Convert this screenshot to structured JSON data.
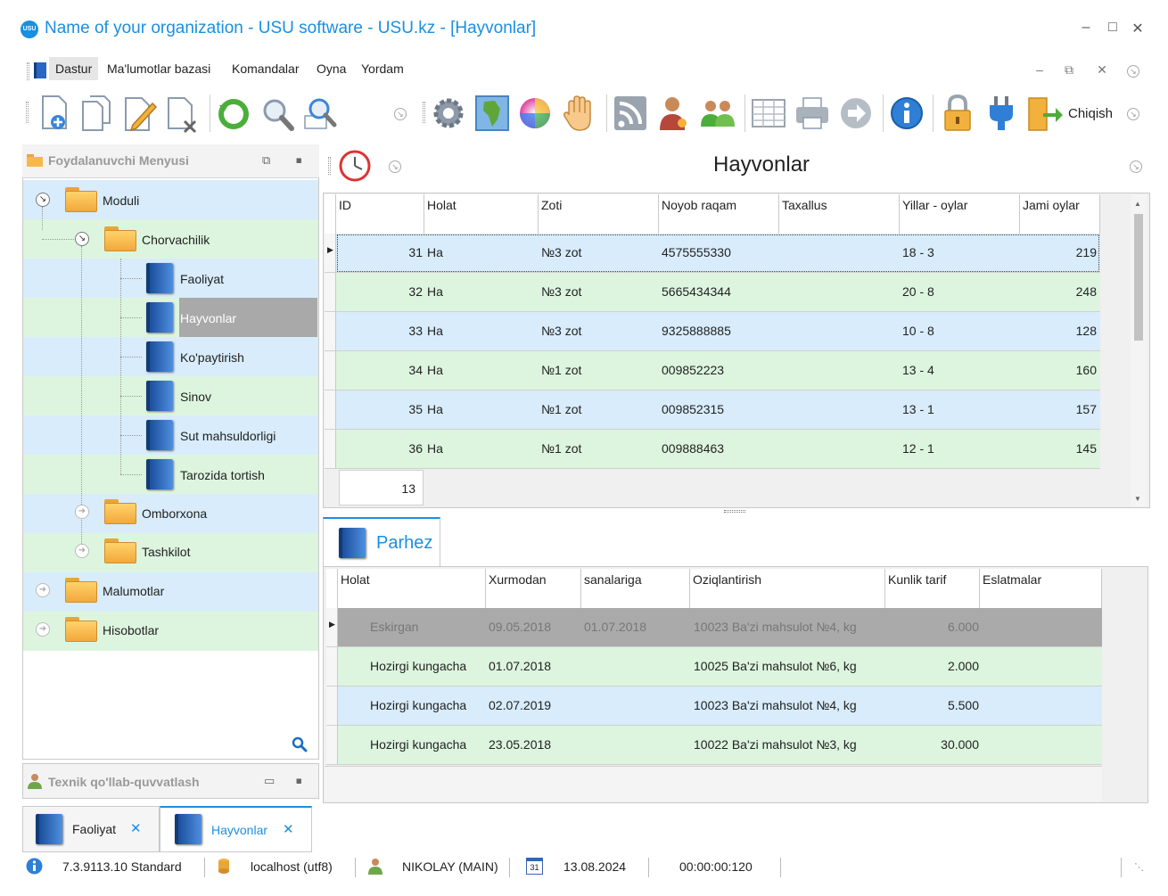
{
  "window": {
    "logo_text": "USU",
    "title": "Name of your organization - USU software - USU.kz - [Hayvonlar]"
  },
  "menu": {
    "items": [
      "Dastur",
      "Ma'lumotlar bazasi",
      "Komandalar",
      "Oyna",
      "Yordam"
    ]
  },
  "toolbar": {
    "exit_label": "Chiqish"
  },
  "left_panel": {
    "title": "Foydalanuvchi Menyusi",
    "tree": [
      {
        "label": "Moduli"
      },
      {
        "label": "Chorvachilik"
      },
      {
        "label": "Faoliyat"
      },
      {
        "label": "Hayvonlar"
      },
      {
        "label": "Ko'paytirish"
      },
      {
        "label": "Sinov"
      },
      {
        "label": "Sut mahsuldorligi"
      },
      {
        "label": "Tarozida tortish"
      },
      {
        "label": "Omborxona"
      },
      {
        "label": "Tashkilot"
      },
      {
        "label": "Malumotlar"
      },
      {
        "label": "Hisobotlar"
      }
    ]
  },
  "support_panel": {
    "title": "Texnik qo'llab-quvvatlash"
  },
  "doc_tabs": [
    {
      "label": "Faoliyat"
    },
    {
      "label": "Hayvonlar"
    }
  ],
  "view": {
    "title": "Hayvonlar"
  },
  "grid1": {
    "headers": [
      "ID",
      "Holat",
      "Zoti",
      "Noyob raqam",
      "Taxallus",
      "Yillar - oylar",
      "Jami oylar"
    ],
    "rows": [
      {
        "id": "31",
        "holat": "Ha",
        "zoti": "№3 zot",
        "noyob": "4575555330",
        "taxallus": "",
        "yillar": "18 - 3",
        "jami": "219"
      },
      {
        "id": "32",
        "holat": "Ha",
        "zoti": "№3 zot",
        "noyob": "5665434344",
        "taxallus": "",
        "yillar": "20 - 8",
        "jami": "248"
      },
      {
        "id": "33",
        "holat": "Ha",
        "zoti": "№3 zot",
        "noyob": "9325888885",
        "taxallus": "",
        "yillar": "10 - 8",
        "jami": "128"
      },
      {
        "id": "34",
        "holat": "Ha",
        "zoti": "№1 zot",
        "noyob": "009852223",
        "taxallus": "",
        "yillar": "13 - 4",
        "jami": "160"
      },
      {
        "id": "35",
        "holat": "Ha",
        "zoti": "№1 zot",
        "noyob": "009852315",
        "taxallus": "",
        "yillar": "13 - 1",
        "jami": "157"
      },
      {
        "id": "36",
        "holat": "Ha",
        "zoti": "№1 zot",
        "noyob": "009888463",
        "taxallus": "",
        "yillar": "12 - 1",
        "jami": "145"
      }
    ],
    "count": "13"
  },
  "detail": {
    "tab_label": "Parhez",
    "headers": [
      "Holat",
      "Xurmodan",
      "sanalariga",
      "Oziqlantirish",
      "Kunlik tarif",
      "Eslatmalar"
    ],
    "rows": [
      {
        "holat": "Eskirgan",
        "xurmodan": "09.05.2018",
        "sanalariga": "01.07.2018",
        "oziq": "10023 Ba'zi mahsulot №4, kg",
        "tarif": "6.000",
        "eslatma": ""
      },
      {
        "holat": "Hozirgi kungacha",
        "xurmodan": "01.07.2018",
        "sanalariga": "",
        "oziq": "10025 Ba'zi mahsulot №6, kg",
        "tarif": "2.000",
        "eslatma": ""
      },
      {
        "holat": "Hozirgi kungacha",
        "xurmodan": "02.07.2019",
        "sanalariga": "",
        "oziq": "10023 Ba'zi mahsulot №4, kg",
        "tarif": "5.500",
        "eslatma": ""
      },
      {
        "holat": "Hozirgi kungacha",
        "xurmodan": "23.05.2018",
        "sanalariga": "",
        "oziq": "10022 Ba'zi mahsulot №3, kg",
        "tarif": "30.000",
        "eslatma": ""
      }
    ]
  },
  "status": {
    "version": "7.3.9113.10 Standard",
    "server": "localhost (utf8)",
    "user": "NIKOLAY (MAIN)",
    "calendar_day": "31",
    "date": "13.08.2024",
    "timer": "00:00:00:120"
  },
  "colors": {
    "accent": "#1a8fe0",
    "row_blue": "#d8ecfb",
    "row_green": "#ddf5df",
    "row_selected": "#aaaaaa"
  }
}
